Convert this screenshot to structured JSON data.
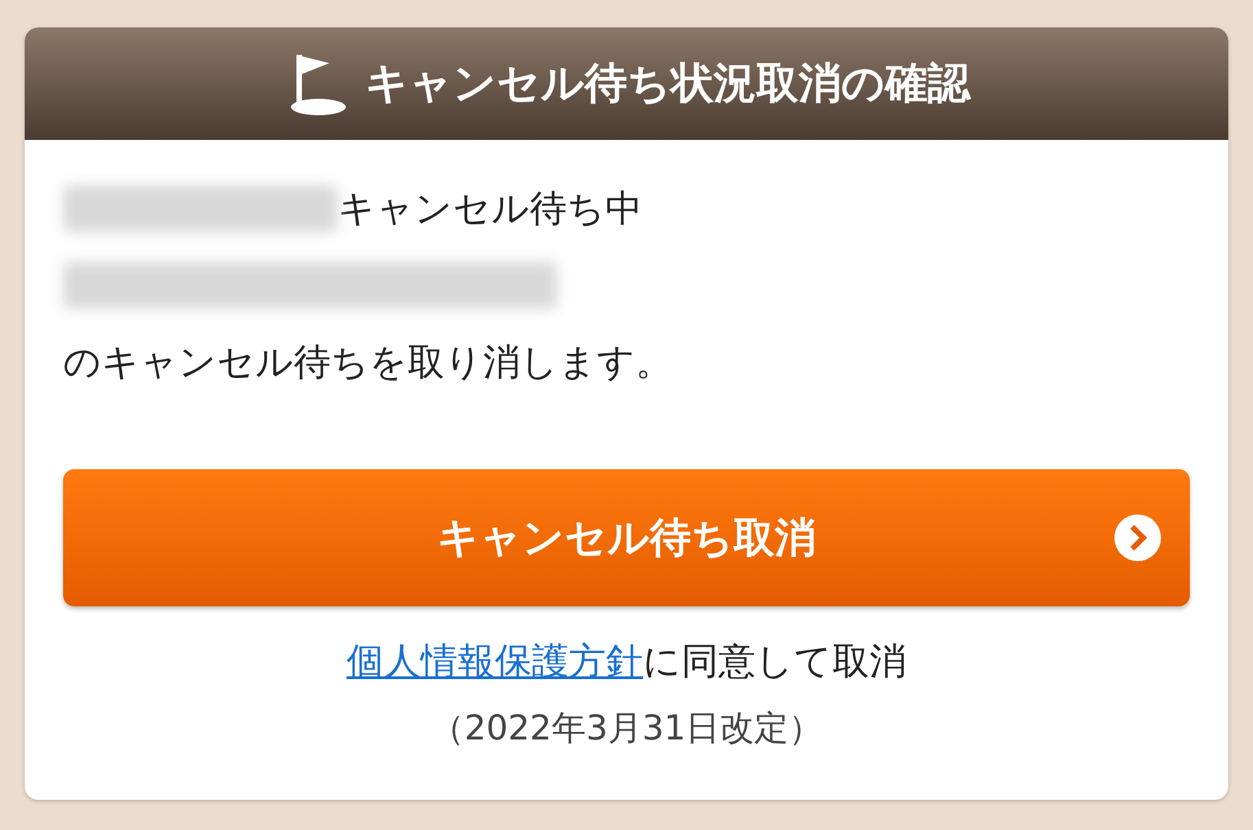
{
  "dialog": {
    "title": "キャンセル待ち状況取消の確認",
    "status_text": "キャンセル待ち中",
    "message": "のキャンセル待ちを取り消します。",
    "confirm_button": "キャンセル待ち取消",
    "consent": {
      "link": "個人情報保護方針",
      "text": "に同意して取消"
    },
    "revision_note": "（2022年3月31日改定）"
  }
}
